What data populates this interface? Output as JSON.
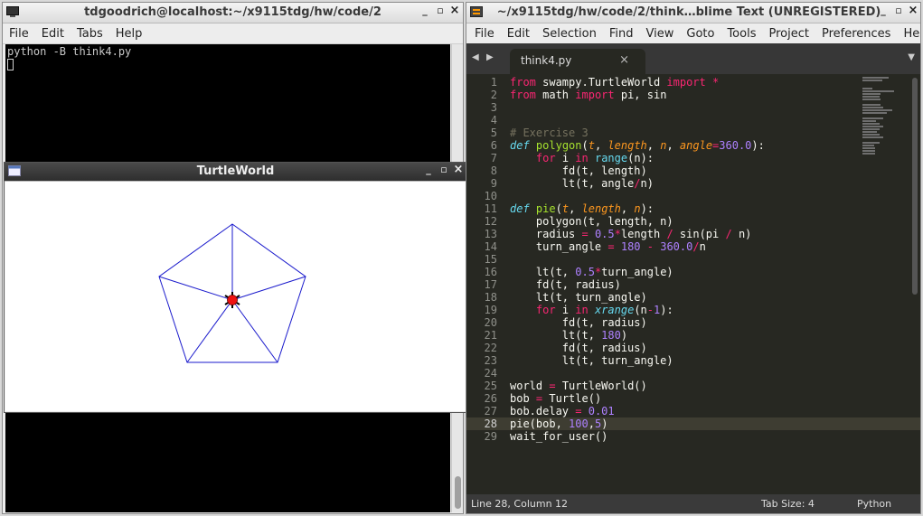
{
  "terminal": {
    "title": "tdgoodrich@localhost:~/x9115tdg/hw/code/2",
    "menu": [
      "File",
      "Edit",
      "Tabs",
      "Help"
    ],
    "command": "python -B think4.py",
    "controls": {
      "minimize": "_",
      "maximize": "▫",
      "close": "×"
    }
  },
  "turtle": {
    "title": "TurtleWorld",
    "controls": {
      "minimize": "_",
      "maximize": "▫",
      "close": "×"
    },
    "colors": {
      "lines": "#1a1acc",
      "turtle": "#ee1111"
    }
  },
  "sublime": {
    "title": "~/x9115tdg/hw/code/2/think…blime Text (UNREGISTERED)",
    "menu": [
      "File",
      "Edit",
      "Selection",
      "Find",
      "View",
      "Goto",
      "Tools",
      "Project",
      "Preferences",
      "Help"
    ],
    "controls": {
      "minimize": "_",
      "maximize": "▫",
      "close": "×"
    },
    "tab": {
      "label": "think4.py",
      "close": "×"
    },
    "nav": {
      "back": "◀",
      "forward": "▶",
      "dropdown": "▼"
    },
    "current_line": 28,
    "code": [
      "from swampy.TurtleWorld import *",
      "from math import pi, sin",
      "",
      "",
      "# Exercise 3",
      "def polygon(t, length, n, angle=360.0):",
      "    for i in range(n):",
      "        fd(t, length)",
      "        lt(t, angle/n)",
      "",
      "def pie(t, length, n):",
      "    polygon(t, length, n)",
      "    radius = 0.5*length / sin(pi / n)",
      "    turn_angle = 180 - 360.0/n",
      "",
      "    lt(t, 0.5*turn_angle)",
      "    fd(t, radius)",
      "    lt(t, turn_angle)",
      "    for i in xrange(n-1):",
      "        fd(t, radius)",
      "        lt(t, 180)",
      "        fd(t, radius)",
      "        lt(t, turn_angle)",
      "",
      "world = TurtleWorld()",
      "bob = Turtle()",
      "bob.delay = 0.01",
      "pie(bob, 100,5)",
      "wait_for_user()"
    ],
    "status": {
      "position": "Line 28, Column 12",
      "tab_size": "Tab Size: 4",
      "syntax": "Python"
    }
  }
}
